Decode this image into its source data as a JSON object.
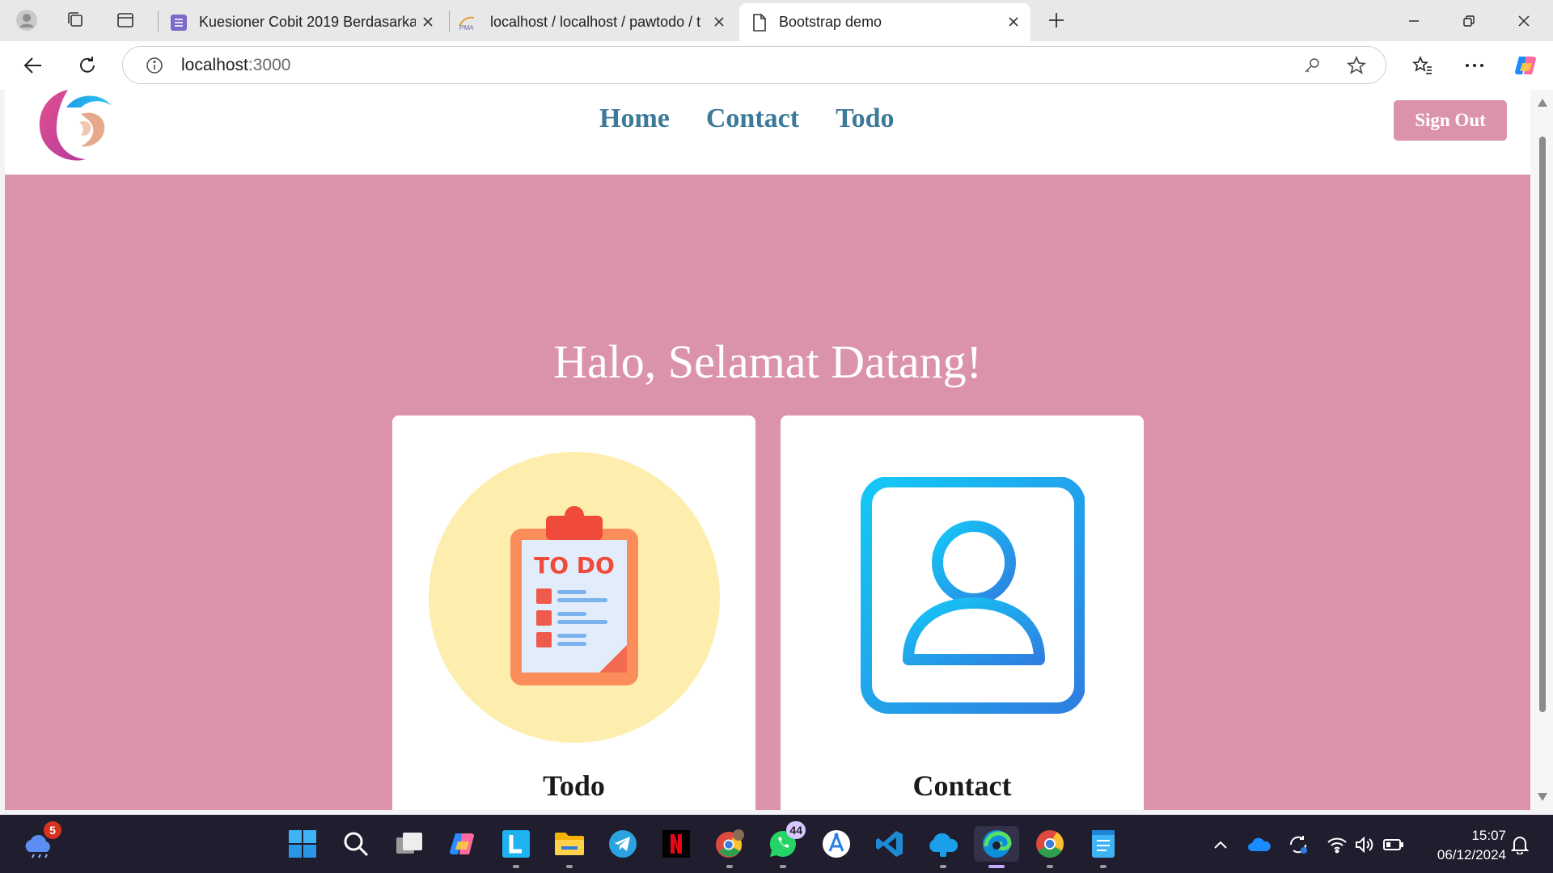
{
  "browser": {
    "tabs": [
      {
        "title": "Kuesioner Cobit 2019 Berdasarkan",
        "active": false
      },
      {
        "title": "localhost / localhost / pawtodo / t",
        "active": false
      },
      {
        "title": "Bootstrap demo",
        "active": true
      }
    ],
    "url_host": "localhost",
    "url_port": ":3000"
  },
  "page": {
    "nav": {
      "home": "Home",
      "contact": "Contact",
      "todo": "Todo"
    },
    "signout": "Sign Out",
    "hero_title": "Halo, Selamat Datang!",
    "cards": [
      {
        "title": "Todo",
        "icon": "todo-clipboard-icon",
        "icon_text": "TO DO"
      },
      {
        "title": "Contact",
        "icon": "contact-book-icon"
      }
    ],
    "colors": {
      "hero_bg": "#db93ab",
      "nav_link": "#3d7a9a",
      "signout_bg": "#db93ab"
    }
  },
  "taskbar": {
    "badges": {
      "weather": "5",
      "whatsapp": "44"
    },
    "time": "15:07",
    "date": "06/12/2024"
  }
}
